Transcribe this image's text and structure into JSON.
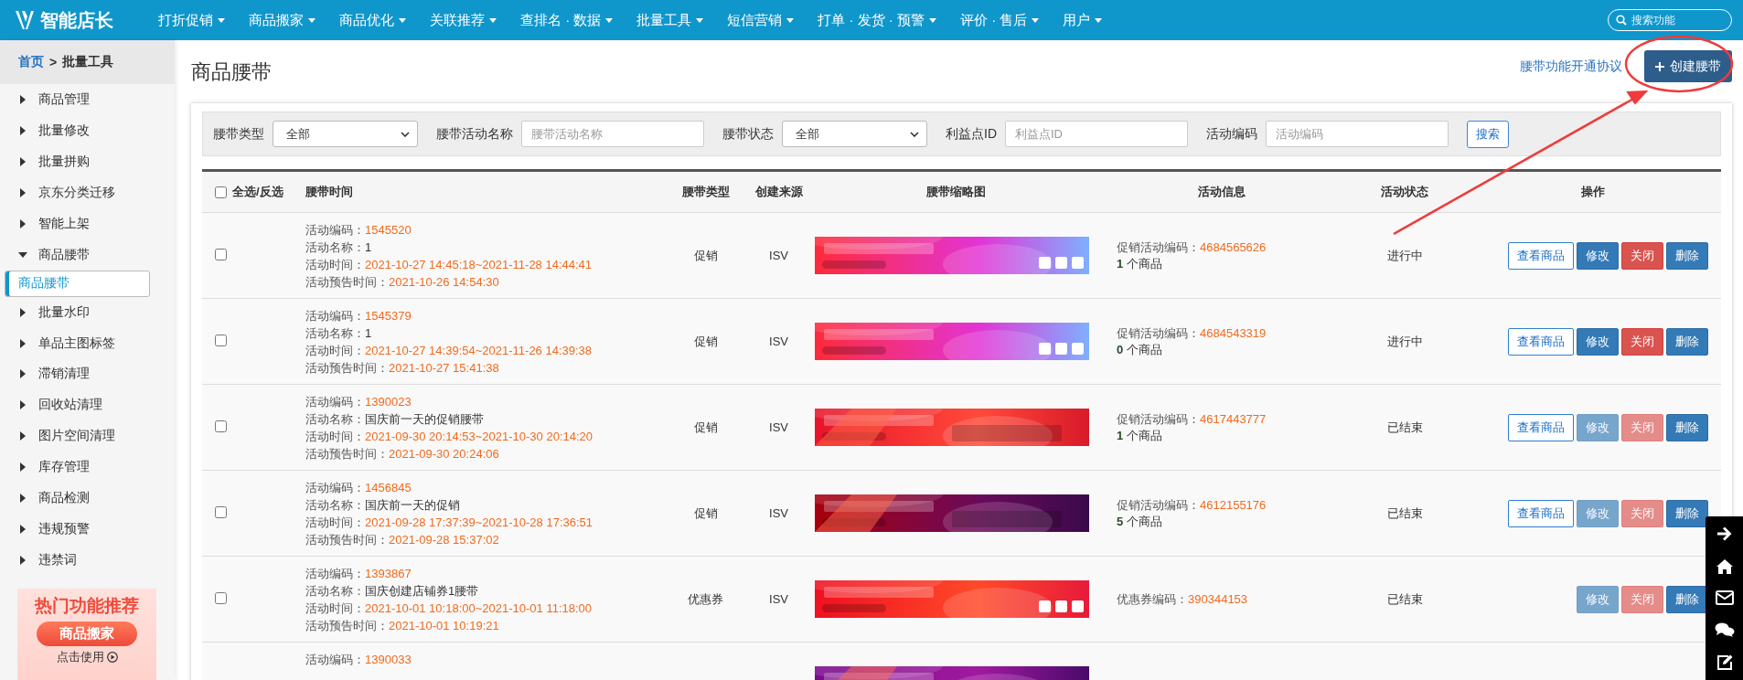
{
  "nav": {
    "logo": "智能店长",
    "menu": [
      {
        "label": "打折促销"
      },
      {
        "label": "商品搬家"
      },
      {
        "label": "商品优化"
      },
      {
        "label": "关联推荐"
      },
      {
        "label": "查排名 · 数据"
      },
      {
        "label": "批量工具"
      },
      {
        "label": "短信营销"
      },
      {
        "label": "打单 · 发货 · 预警"
      },
      {
        "label": "评价 · 售后"
      },
      {
        "label": "用户"
      }
    ],
    "search": {
      "placeholder": "搜索功能"
    }
  },
  "breadcrumb": {
    "home": "首页",
    "separator": ">",
    "current": "批量工具"
  },
  "sidebar": {
    "items": [
      {
        "label": "商品管理",
        "expanded": false
      },
      {
        "label": "批量修改",
        "expanded": false
      },
      {
        "label": "批量拼购",
        "expanded": false
      },
      {
        "label": "京东分类迁移",
        "expanded": false
      },
      {
        "label": "智能上架",
        "expanded": false
      },
      {
        "label": "商品腰带",
        "expanded": true,
        "children": [
          {
            "label": "商品腰带",
            "selected": true
          }
        ]
      },
      {
        "label": "批量水印",
        "expanded": false
      },
      {
        "label": "单品主图标签",
        "expanded": false
      },
      {
        "label": "滞销清理",
        "expanded": false
      },
      {
        "label": "回收站清理",
        "expanded": false
      },
      {
        "label": "图片空间清理",
        "expanded": false
      },
      {
        "label": "库存管理",
        "expanded": false
      },
      {
        "label": "商品检测",
        "expanded": false
      },
      {
        "label": "违规预警",
        "expanded": false
      },
      {
        "label": "违禁词",
        "expanded": false
      }
    ],
    "promo": {
      "title": "热门功能推荐",
      "button": "商品搬家",
      "link": "点击使用"
    }
  },
  "page": {
    "title": "商品腰带",
    "agreement_link": "腰带功能开通协议",
    "create_button": "创建腰带"
  },
  "filters": [
    {
      "kind": "select",
      "label": "腰带类型",
      "value": "全部"
    },
    {
      "kind": "input",
      "label": "腰带活动名称",
      "placeholder": "腰带活动名称"
    },
    {
      "kind": "select",
      "label": "腰带状态",
      "value": "全部"
    },
    {
      "kind": "input",
      "label": "利益点ID",
      "placeholder": "利益点ID"
    },
    {
      "kind": "input",
      "label": "活动编码",
      "placeholder": "活动编码"
    }
  ],
  "search_button": "搜索",
  "table": {
    "select_all": {
      "label": "全选/反选",
      "checked": false
    },
    "columns": [
      "腰带时间",
      "腰带类型",
      "创建来源",
      "腰带缩略图",
      "活动信息",
      "活动状态",
      "操作"
    ],
    "rows": [
      {
        "checked": false,
        "lines": [
          {
            "label": "活动编码：",
            "value": "1545520",
            "accent": true
          },
          {
            "label": "活动名称：",
            "value": "1",
            "accent": false
          },
          {
            "label": "活动时间：",
            "value": "2021-10-27 14:45:18~2021-11-28 14:44:41",
            "accent": true
          },
          {
            "label": "活动预告时间：",
            "value": "2021-10-26 14:54:30",
            "accent": true
          }
        ],
        "type": "促销",
        "source": "ISV",
        "info": {
          "label": "促销活动编码：",
          "value": "4684565626",
          "count": "**1** 个商品"
        },
        "status": "进行中",
        "actions": [
          {
            "kind": "view",
            "label": "查看商品",
            "disabled": false
          },
          {
            "kind": "edit",
            "label": "修改",
            "disabled": false
          },
          {
            "kind": "close",
            "label": "关闭",
            "disabled": false
          },
          {
            "kind": "delete",
            "label": "删除",
            "disabled": false
          }
        ]
      },
      {
        "checked": false,
        "lines": [
          {
            "label": "活动编码：",
            "value": "1545379",
            "accent": true
          },
          {
            "label": "活动名称：",
            "value": "1",
            "accent": false
          },
          {
            "label": "活动时间：",
            "value": "2021-10-27 14:39:54~2021-11-26 14:39:38",
            "accent": true
          },
          {
            "label": "活动预告时间：",
            "value": "2021-10-27 15:41:38",
            "accent": true
          }
        ],
        "type": "促销",
        "source": "ISV",
        "info": {
          "label": "促销活动编码：",
          "value": "4684543319",
          "count": "**0** 个商品"
        },
        "status": "进行中",
        "actions": [
          {
            "kind": "view",
            "label": "查看商品",
            "disabled": false
          },
          {
            "kind": "edit",
            "label": "修改",
            "disabled": false
          },
          {
            "kind": "close",
            "label": "关闭",
            "disabled": false
          },
          {
            "kind": "delete",
            "label": "删除",
            "disabled": false
          }
        ]
      },
      {
        "checked": false,
        "lines": [
          {
            "label": "活动编码：",
            "value": "1390023",
            "accent": true
          },
          {
            "label": "活动名称：",
            "value": "国庆前一天的促销腰带",
            "accent": false
          },
          {
            "label": "活动时间：",
            "value": "2021-09-30 20:14:53~2021-10-30 20:14:20",
            "accent": true
          },
          {
            "label": "活动预告时间：",
            "value": "2021-09-30 20:24:06",
            "accent": true
          }
        ],
        "type": "促销",
        "source": "ISV",
        "info": {
          "label": "促销活动编码：",
          "value": "4617443777",
          "count": "**1** 个商品"
        },
        "status": "已结束",
        "actions": [
          {
            "kind": "view",
            "label": "查看商品",
            "disabled": false
          },
          {
            "kind": "edit",
            "label": "修改",
            "disabled": true
          },
          {
            "kind": "close",
            "label": "关闭",
            "disabled": true
          },
          {
            "kind": "delete",
            "label": "删除",
            "disabled": false
          }
        ]
      },
      {
        "checked": false,
        "lines": [
          {
            "label": "活动编码：",
            "value": "1456845",
            "accent": true
          },
          {
            "label": "活动名称：",
            "value": "国庆前一天的促销",
            "accent": false
          },
          {
            "label": "活动时间：",
            "value": "2021-09-28 17:37:39~2021-10-28 17:36:51",
            "accent": true
          },
          {
            "label": "活动预告时间：",
            "value": "2021-09-28 15:37:02",
            "accent": true
          }
        ],
        "type": "促销",
        "source": "ISV",
        "info": {
          "label": "促销活动编码：",
          "value": "4612155176",
          "count": "**5** 个商品"
        },
        "status": "已结束",
        "actions": [
          {
            "kind": "view",
            "label": "查看商品",
            "disabled": false
          },
          {
            "kind": "edit",
            "label": "修改",
            "disabled": true
          },
          {
            "kind": "close",
            "label": "关闭",
            "disabled": true
          },
          {
            "kind": "delete",
            "label": "删除",
            "disabled": false
          }
        ]
      },
      {
        "checked": false,
        "lines": [
          {
            "label": "活动编码：",
            "value": "1393867",
            "accent": true
          },
          {
            "label": "活动名称：",
            "value": "国庆创建店铺券1腰带",
            "accent": false
          },
          {
            "label": "活动时间：",
            "value": "2021-10-01 10:18:00~2021-10-01 11:18:00",
            "accent": true
          },
          {
            "label": "活动预告时间：",
            "value": "2021-10-01 10:19:21",
            "accent": true
          }
        ],
        "type": "优惠券",
        "source": "ISV",
        "info": {
          "label": "优惠券编码：",
          "value": "390344153"
        },
        "status": "已结束",
        "actions": [
          {
            "kind": "edit",
            "label": "修改",
            "disabled": true
          },
          {
            "kind": "close",
            "label": "关闭",
            "disabled": true
          },
          {
            "kind": "delete",
            "label": "删除",
            "disabled": false
          }
        ]
      },
      {
        "lines": [
          {
            "label": "活动编码：",
            "value": "1390033",
            "accent": true
          }
        ]
      }
    ]
  }
}
